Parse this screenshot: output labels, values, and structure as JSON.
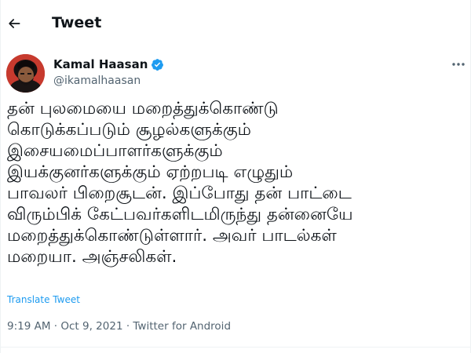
{
  "header": {
    "back_icon": "arrow-left-icon",
    "title": "Tweet"
  },
  "author": {
    "name": "Kamal Haasan",
    "handle": "@ikamalhaasan",
    "verified_icon": "verified-badge-icon",
    "more_icon": "more-horizontal-icon"
  },
  "tweet": {
    "lines": [
      "தன் புலமையை மறைத்துக்கொண்டு",
      "கொடுக்கப்படும் சூழல்களுக்கும்",
      "இசையமைப்பாளர்களுக்கும்",
      "இயக்குனர்களுக்கும் ஏற்றபடி எழுதும்",
      "பாவலர் பிறைசூடன். இப்போது தன் பாட்டை",
      "விரும்பிக் கேட்பவர்களிடமிருந்து தன்னையே",
      "மறைத்துக்கொண்டுள்ளார். அவர் பாடல்கள்",
      "மறையா. அஞ்சலிகள்."
    ],
    "translate_label": "Translate Tweet",
    "time": "9:19 AM",
    "separator": " · ",
    "date": "Oct 9, 2021",
    "source": "Twitter for Android"
  },
  "colors": {
    "accent": "#1d9bf0",
    "secondary_text": "#536471",
    "primary_text": "#0f1419",
    "divider": "#eff3f4"
  }
}
